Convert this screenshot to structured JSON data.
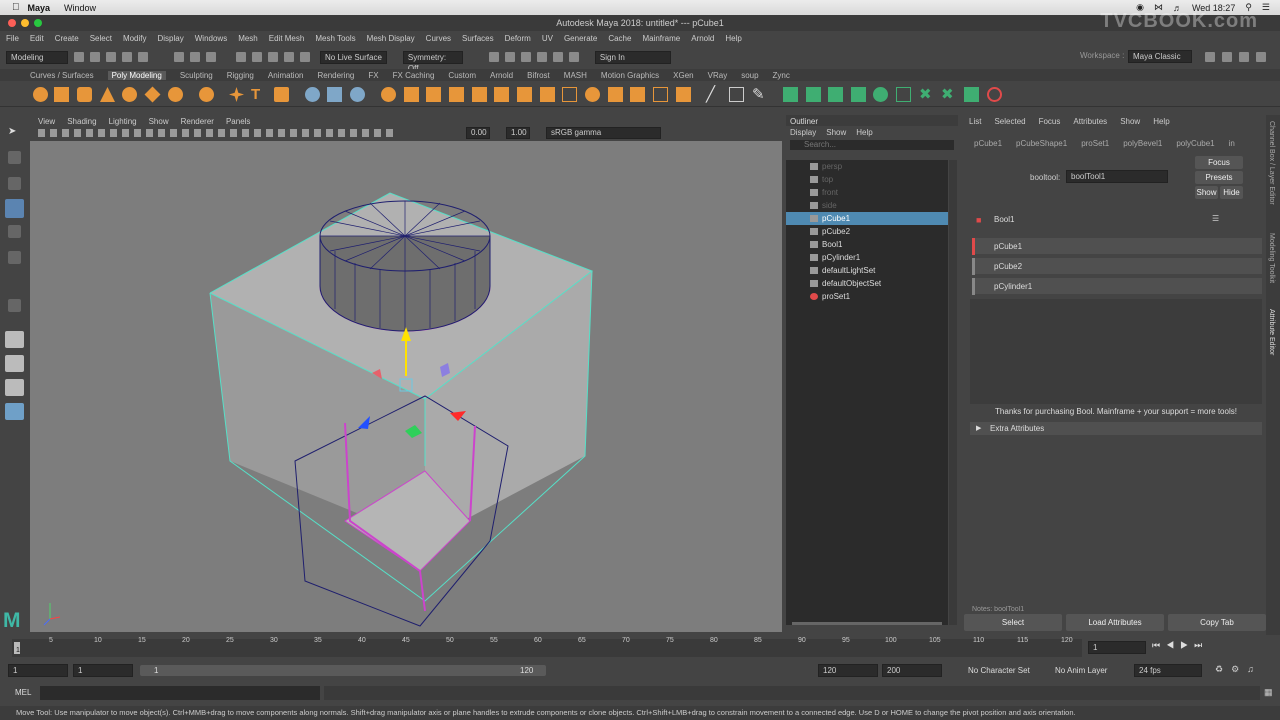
{
  "mac": {
    "app": "Maya",
    "window": "Window",
    "clock": "Wed 18:27"
  },
  "title": "Autodesk Maya 2018: untitled*   ---   pCube1",
  "watermark": "TVCBOOK.com",
  "menus": [
    "File",
    "Edit",
    "Create",
    "Select",
    "Modify",
    "Display",
    "Windows",
    "Mesh",
    "Edit Mesh",
    "Mesh Tools",
    "Mesh Display",
    "Curves",
    "Surfaces",
    "Deform",
    "UV",
    "Generate",
    "Cache",
    "Mainframe",
    "Arnold",
    "Help"
  ],
  "status": {
    "mode": "Modeling",
    "live": "No Live Surface",
    "symmetry": "Symmetry: Off",
    "signin": "Sign In",
    "workspace": "Workspace :",
    "workspace_value": "Maya Classic"
  },
  "shelf_tabs": [
    "Curves / Surfaces",
    "Poly Modeling",
    "Sculpting",
    "Rigging",
    "Animation",
    "Rendering",
    "FX",
    "FX Caching",
    "Custom",
    "Arnold",
    "Bifrost",
    "MASH",
    "Motion Graphics",
    "XGen",
    "VRay",
    "soup",
    "Zync"
  ],
  "viewport": {
    "menus": [
      "View",
      "Shading",
      "Lighting",
      "Show",
      "Renderer",
      "Panels"
    ],
    "val1": "0.00",
    "val2": "1.00",
    "colorspace": "sRGB gamma"
  },
  "outliner": {
    "title": "Outliner",
    "menus": [
      "Display",
      "Show",
      "Help"
    ],
    "search": "Search...",
    "items": [
      {
        "label": "persp",
        "state": "dim"
      },
      {
        "label": "top",
        "state": "dim"
      },
      {
        "label": "front",
        "state": "dim"
      },
      {
        "label": "side",
        "state": "dim"
      },
      {
        "label": "pCube1",
        "state": "sel"
      },
      {
        "label": "pCube2",
        "state": ""
      },
      {
        "label": "Bool1",
        "state": ""
      },
      {
        "label": "pCylinder1",
        "state": ""
      },
      {
        "label": "defaultLightSet",
        "state": ""
      },
      {
        "label": "defaultObjectSet",
        "state": ""
      },
      {
        "label": "proSet1",
        "state": ""
      }
    ]
  },
  "ae": {
    "menus": [
      "List",
      "Selected",
      "Focus",
      "Attributes",
      "Show",
      "Help"
    ],
    "tabs": [
      "pCube1",
      "pCubeShape1",
      "proSet1",
      "polyBevel1",
      "polyCube1",
      "in"
    ],
    "booltool_label": "booltool:",
    "booltool_value": "boolTool1",
    "focus": "Focus",
    "presets": "Presets",
    "show": "Show",
    "hide": "Hide",
    "bool_title": "Bool1",
    "operands": [
      "pCube1",
      "pCube2",
      "pCylinder1"
    ],
    "thanks": "Thanks for purchasing Bool. Mainframe + your support = more tools!",
    "extra": "Extra Attributes",
    "notes": "Notes: boolTool1",
    "btn_select": "Select",
    "btn_load": "Load Attributes",
    "btn_copy": "Copy Tab"
  },
  "side_tabs": [
    "Channel Box / Layer Editor",
    "Modeling Toolkit",
    "Attribute Editor"
  ],
  "timeline": {
    "ticks": [
      "1",
      "5",
      "10",
      "15",
      "20",
      "25",
      "30",
      "35",
      "40",
      "45",
      "50",
      "55",
      "60",
      "65",
      "70",
      "75",
      "80",
      "85",
      "90",
      "95",
      "100",
      "105",
      "110",
      "115",
      "120"
    ],
    "current": "1"
  },
  "range": {
    "start": "1",
    "start2": "1",
    "slider_start": "1",
    "slider_end": "120",
    "end": "120",
    "end2": "200",
    "charset": "No Character Set",
    "animlayer": "No Anim Layer",
    "fps": "24 fps"
  },
  "cmd_label": "MEL",
  "help": "Move Tool: Use manipulator to move object(s). Ctrl+MMB+drag to move components along normals. Shift+drag manipulator axis or plane handles to extrude components or clone objects. Ctrl+Shift+LMB+drag to constrain movement to a connected edge. Use D or HOME to change the pivot position and axis orientation."
}
